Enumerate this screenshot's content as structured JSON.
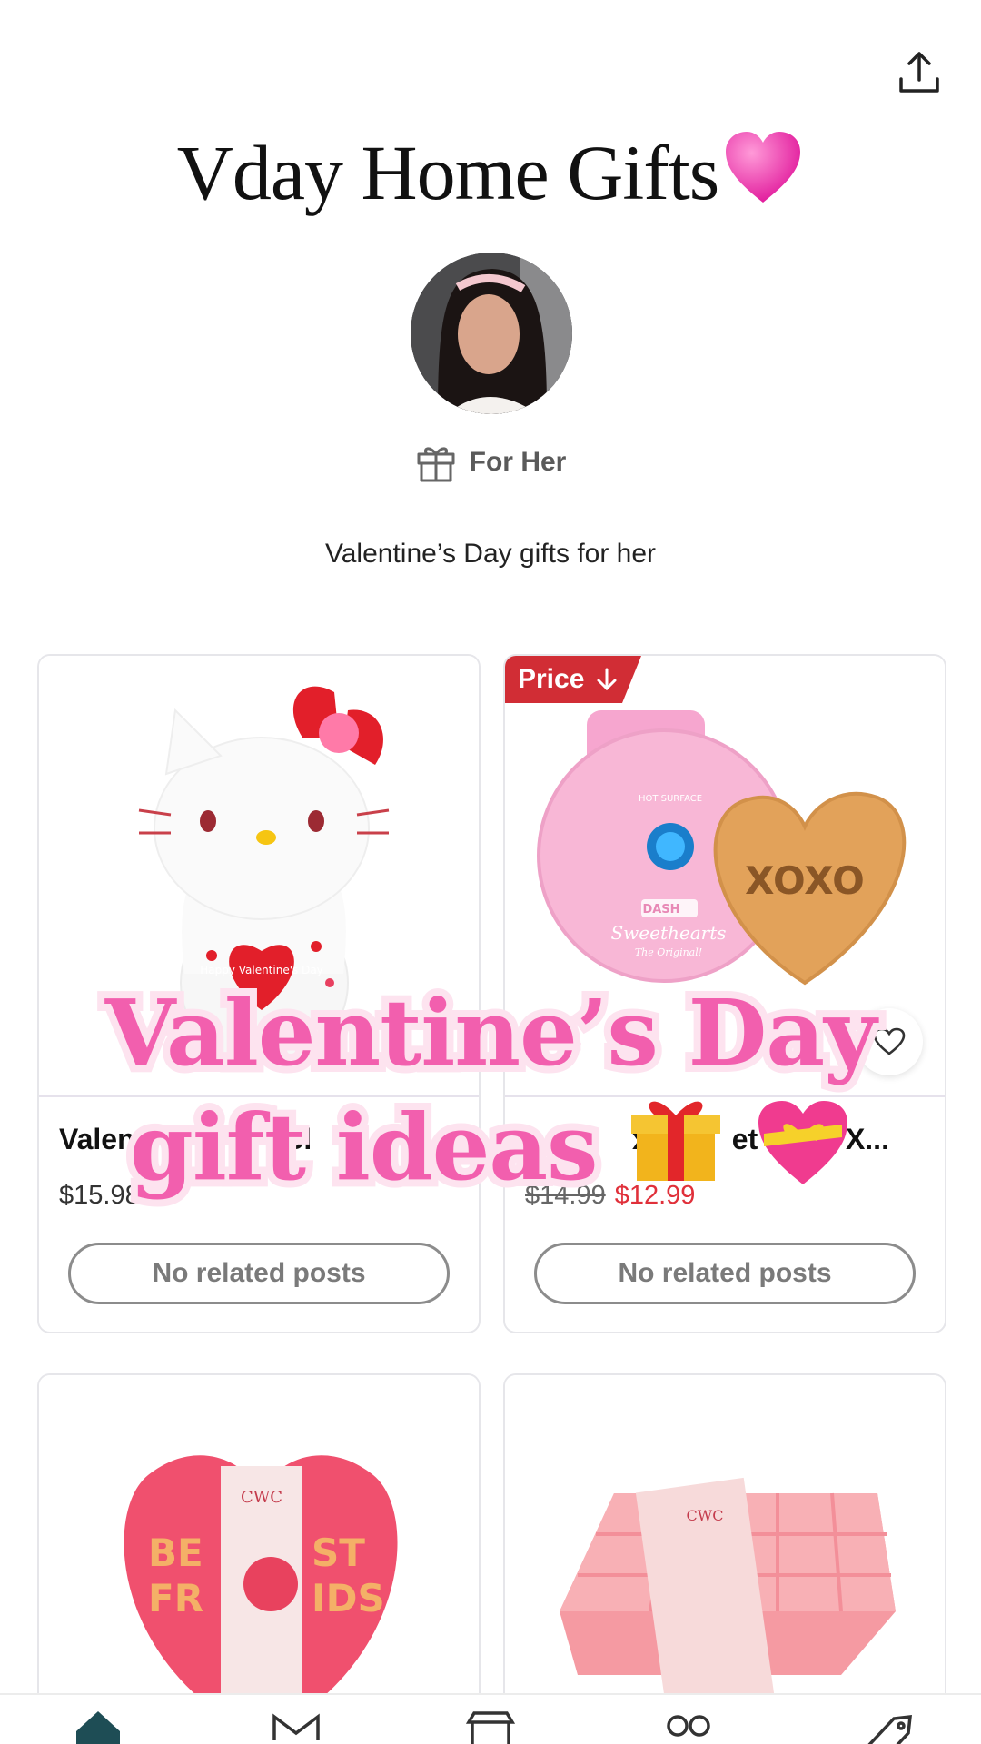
{
  "header": {
    "title": "Vday Home Gifts",
    "title_emoji": "heart-icon",
    "share_icon": "share-icon"
  },
  "profile": {
    "avatar": "avatar"
  },
  "category": {
    "icon": "gift-icon",
    "label": "For Her"
  },
  "description": "Valentine’s Day gifts for her",
  "products": [
    {
      "name": "Valent",
      "name_tail": "Bl",
      "price": "$15.98",
      "related": "No related posts"
    },
    {
      "badge": "Price",
      "name_fragment_1": "x",
      "name_fragment_2": "et",
      "name_tail": "s X...",
      "old_price": "$14.99",
      "sale_price": "$12.99",
      "related": "No related posts",
      "favorite_icon": "heart-outline-icon"
    },
    {
      "image_text_1": "BE",
      "image_text_2": "ST",
      "image_text_3": "FR",
      "image_text_4": "IDS",
      "image_brand": "CWC"
    },
    {
      "image_brand": "CWC"
    }
  ],
  "product_image_text": {
    "waffle_heart": "XOXO",
    "waffle_brand": "Sweethearts",
    "waffle_sub": "The Original!",
    "waffle_top": "HOT SURFACE",
    "dash": "DASH",
    "kitty_heart": "Happy Valentine's Day"
  },
  "overlay": {
    "line1": "Valentine’s Day",
    "line2": "gift ideas",
    "emoji1": "gift-icon",
    "emoji2": "heart-ribbon-icon"
  },
  "tabs": [
    "home-icon",
    "inbox-icon",
    "shop-icon",
    "collections-icon",
    "deals-icon"
  ],
  "colors": {
    "accent_pink": "#f25fae",
    "sale_red": "#e0303a",
    "badge_red": "#d12d35"
  }
}
